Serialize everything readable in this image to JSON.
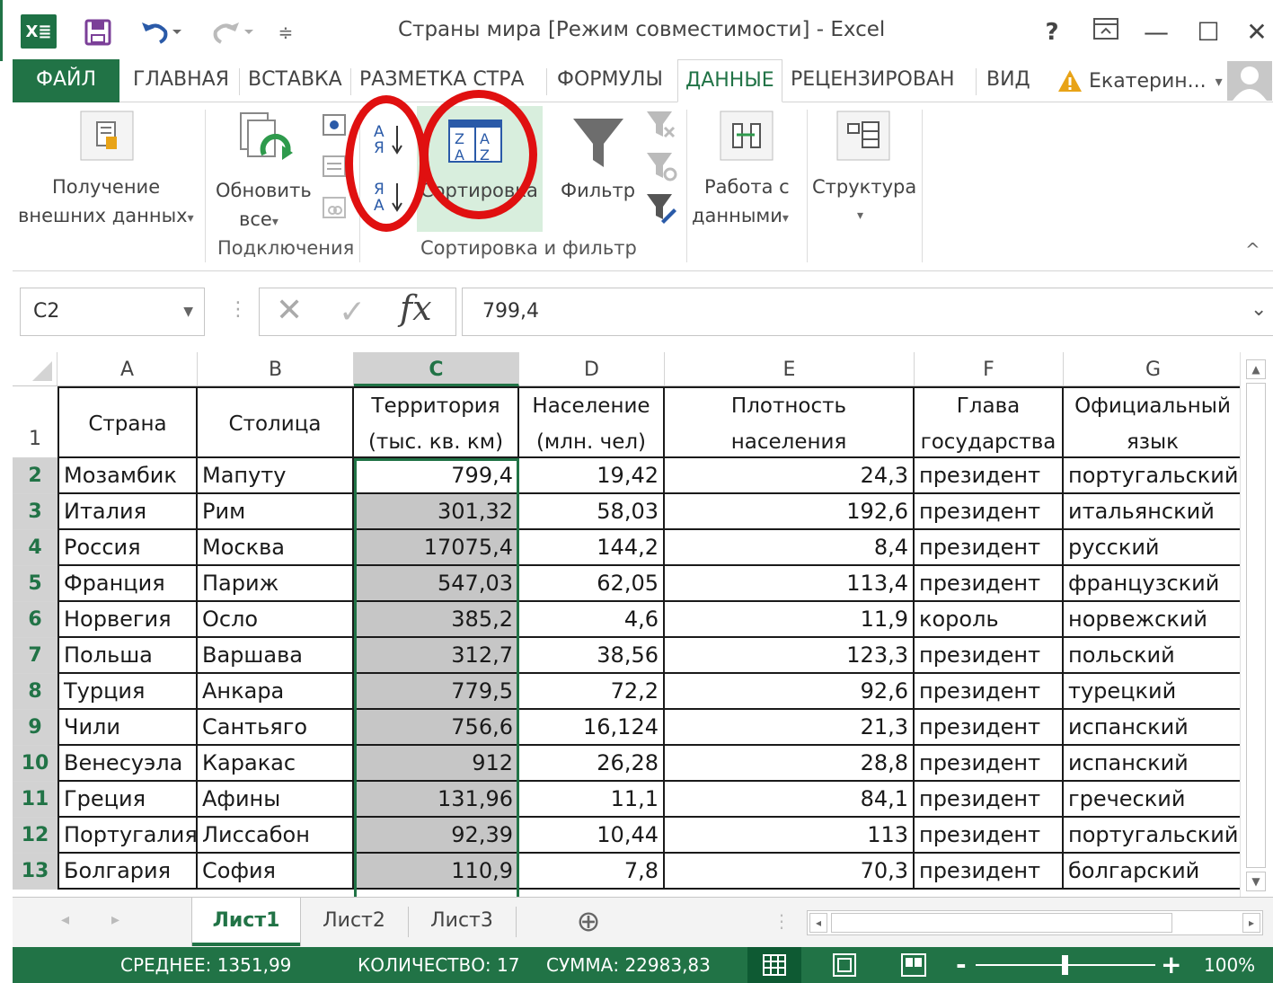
{
  "window": {
    "title": "Страны мира  [Режим совместимости] - Excel",
    "help": "?",
    "min": "—",
    "max": "☐",
    "close": "✕"
  },
  "tabs": {
    "file": "ФАЙЛ",
    "home": "ГЛАВНАЯ",
    "insert": "ВСТАВКА",
    "layout": "РАЗМЕТКА СТРА",
    "formulas": "ФОРМУЛЫ",
    "data": "ДАННЫЕ",
    "review": "РЕЦЕНЗИРОВАН",
    "view": "ВИД",
    "user": "Екатерин...",
    "user_arrow": "▾"
  },
  "ribbon": {
    "get_external_1": "Получение",
    "get_external_2": "внешних данных",
    "refresh_1": "Обновить",
    "refresh_2": "все",
    "dropdown_arrow": "▾",
    "connections_label": "Подключения",
    "sort_label": "Сортировка",
    "filter_label": "Фильтр",
    "sort_filter_group": "Сортировка и фильтр",
    "data_tools_1": "Работа с",
    "data_tools_2": "данными",
    "outline": "Структура",
    "collapse": "^"
  },
  "formula_bar": {
    "name_box": "C2",
    "value": "799,4",
    "fx": "fx"
  },
  "grid": {
    "columns": [
      "A",
      "B",
      "C",
      "D",
      "E",
      "F",
      "G"
    ],
    "header_row": {
      "row_no": "1",
      "A": "Страна",
      "B": "Столица",
      "C1": "Территория",
      "C2": "(тыс. кв. км)",
      "D1": "Население",
      "D2": "(млн. чел)",
      "E1": "Плотность",
      "E2": "населения",
      "F1": "Глава",
      "F2": "государства",
      "G1": "Официальный",
      "G2": "язык"
    },
    "rows": [
      {
        "n": "2",
        "a": "Мозамбик",
        "b": "Мапуту",
        "c": "799,4",
        "d": "19,42",
        "e": "24,3",
        "f": "президент",
        "g": "португальский"
      },
      {
        "n": "3",
        "a": "Италия",
        "b": "Рим",
        "c": "301,32",
        "d": "58,03",
        "e": "192,6",
        "f": "президент",
        "g": "итальянский"
      },
      {
        "n": "4",
        "a": "Россия",
        "b": "Москва",
        "c": "17075,4",
        "d": "144,2",
        "e": "8,4",
        "f": "президент",
        "g": "русский"
      },
      {
        "n": "5",
        "a": "Франция",
        "b": "Париж",
        "c": "547,03",
        "d": "62,05",
        "e": "113,4",
        "f": "президент",
        "g": "французский"
      },
      {
        "n": "6",
        "a": "Норвегия",
        "b": "Осло",
        "c": "385,2",
        "d": "4,6",
        "e": "11,9",
        "f": "король",
        "g": "норвежский"
      },
      {
        "n": "7",
        "a": "Польша",
        "b": "Варшава",
        "c": "312,7",
        "d": "38,56",
        "e": "123,3",
        "f": "президент",
        "g": "польский"
      },
      {
        "n": "8",
        "a": "Турция",
        "b": "Анкара",
        "c": "779,5",
        "d": "72,2",
        "e": "92,6",
        "f": "президент",
        "g": "турецкий"
      },
      {
        "n": "9",
        "a": "Чили",
        "b": "Сантьяго",
        "c": "756,6",
        "d": "16,124",
        "e": "21,3",
        "f": "президент",
        "g": "испанский"
      },
      {
        "n": "10",
        "a": "Венесуэла",
        "b": "Каракас",
        "c": "912",
        "d": "26,28",
        "e": "28,8",
        "f": "президент",
        "g": "испанский"
      },
      {
        "n": "11",
        "a": "Греция",
        "b": "Афины",
        "c": "131,96",
        "d": "11,1",
        "e": "84,1",
        "f": "президент",
        "g": "греческий"
      },
      {
        "n": "12",
        "a": "Португалия",
        "b": "Лиссабон",
        "c": "92,39",
        "d": "10,44",
        "e": "113",
        "f": "президент",
        "g": "португальский"
      },
      {
        "n": "13",
        "a": "Болгария",
        "b": "София",
        "c": "110,9",
        "d": "7,8",
        "e": "70,3",
        "f": "президент",
        "g": "болгарский"
      }
    ]
  },
  "sheets": {
    "s1": "Лист1",
    "s2": "Лист2",
    "s3": "Лист3",
    "add": "⊕"
  },
  "status": {
    "avg": "СРЕДНЕЕ: 1351,99",
    "count": "КОЛИЧЕСТВО: 17",
    "sum": "СУММА: 22983,83",
    "zoom": "100%",
    "zoom_minus": "-",
    "zoom_plus": "+"
  },
  "colors": {
    "accent": "#217346",
    "highlight": "#e01010"
  }
}
